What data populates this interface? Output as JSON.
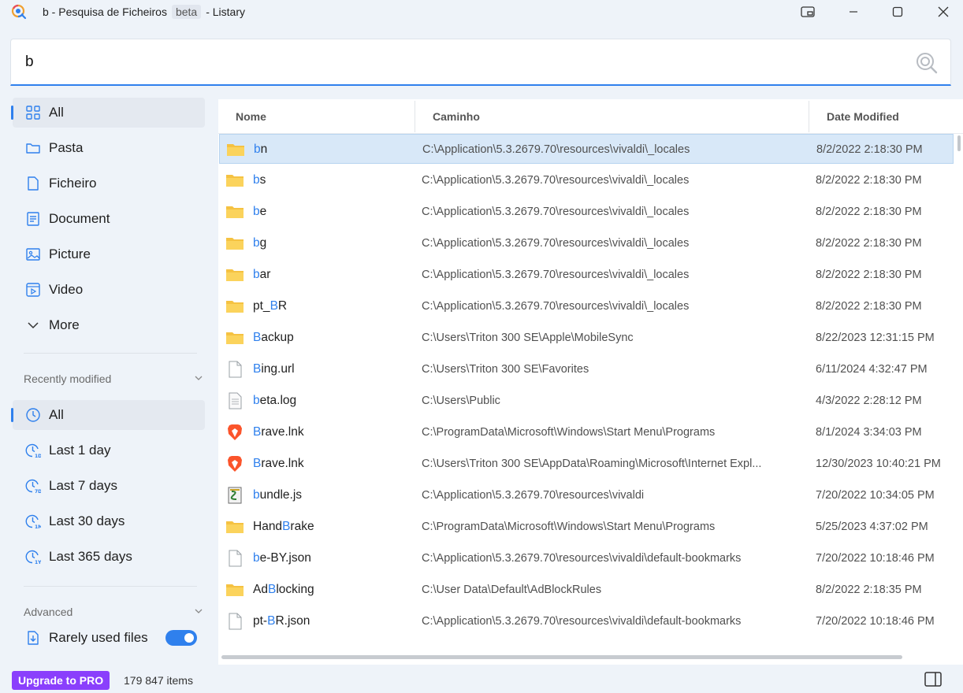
{
  "window": {
    "title": "b - Pesquisa de Ficheiros",
    "badge": "beta",
    "suffix": "- Listary"
  },
  "search": {
    "query": "b"
  },
  "sidebar": {
    "types": [
      {
        "label": "All",
        "icon": "grid-icon",
        "active": true
      },
      {
        "label": "Pasta",
        "icon": "folder-icon"
      },
      {
        "label": "Ficheiro",
        "icon": "file-icon"
      },
      {
        "label": "Document",
        "icon": "document-icon"
      },
      {
        "label": "Picture",
        "icon": "picture-icon"
      },
      {
        "label": "Video",
        "icon": "video-icon"
      },
      {
        "label": "More",
        "icon": "chevron-down-icon"
      }
    ],
    "recent_title": "Recently modified",
    "recent": [
      {
        "label": "All",
        "active": true
      },
      {
        "label": "Last 1 day"
      },
      {
        "label": "Last 7 days"
      },
      {
        "label": "Last 30 days"
      },
      {
        "label": "Last 365 days"
      }
    ],
    "advanced_title": "Advanced",
    "rarely_used": "Rarely used files"
  },
  "table": {
    "headers": {
      "name": "Nome",
      "path": "Caminho",
      "date": "Date Modified"
    },
    "rows": [
      {
        "pre": "",
        "hl": "b",
        "post": "n",
        "type": "folder",
        "path": "C:\\Application\\5.3.2679.70\\resources\\vivaldi\\_locales",
        "date": "8/2/2022 2:18:30 PM",
        "selected": true
      },
      {
        "pre": "",
        "hl": "b",
        "post": "s",
        "type": "folder",
        "path": "C:\\Application\\5.3.2679.70\\resources\\vivaldi\\_locales",
        "date": "8/2/2022 2:18:30 PM"
      },
      {
        "pre": "",
        "hl": "b",
        "post": "e",
        "type": "folder",
        "path": "C:\\Application\\5.3.2679.70\\resources\\vivaldi\\_locales",
        "date": "8/2/2022 2:18:30 PM"
      },
      {
        "pre": "",
        "hl": "b",
        "post": "g",
        "type": "folder",
        "path": "C:\\Application\\5.3.2679.70\\resources\\vivaldi\\_locales",
        "date": "8/2/2022 2:18:30 PM"
      },
      {
        "pre": "",
        "hl": "b",
        "post": "ar",
        "type": "folder",
        "path": "C:\\Application\\5.3.2679.70\\resources\\vivaldi\\_locales",
        "date": "8/2/2022 2:18:30 PM"
      },
      {
        "pre": "pt_",
        "hl": "B",
        "post": "R",
        "type": "folder",
        "path": "C:\\Application\\5.3.2679.70\\resources\\vivaldi\\_locales",
        "date": "8/2/2022 2:18:30 PM"
      },
      {
        "pre": "",
        "hl": "B",
        "post": "ackup",
        "type": "folder",
        "path": "C:\\Users\\Triton 300 SE\\Apple\\MobileSync",
        "date": "8/22/2023 12:31:15 PM"
      },
      {
        "pre": "",
        "hl": "B",
        "post": "ing.url",
        "type": "file",
        "path": "C:\\Users\\Triton 300 SE\\Favorites",
        "date": "6/11/2024 4:32:47 PM"
      },
      {
        "pre": "",
        "hl": "b",
        "post": "eta.log",
        "type": "log",
        "path": "C:\\Users\\Public",
        "date": "4/3/2022 2:28:12 PM"
      },
      {
        "pre": "",
        "hl": "B",
        "post": "rave.lnk",
        "type": "brave",
        "path": "C:\\ProgramData\\Microsoft\\Windows\\Start Menu\\Programs",
        "date": "8/1/2024 3:34:03 PM"
      },
      {
        "pre": "",
        "hl": "B",
        "post": "rave.lnk",
        "type": "brave",
        "path": "C:\\Users\\Triton 300 SE\\AppData\\Roaming\\Microsoft\\Internet Expl...",
        "date": "12/30/2023 10:40:21 PM"
      },
      {
        "pre": "",
        "hl": "b",
        "post": "undle.js",
        "type": "script",
        "path": "C:\\Application\\5.3.2679.70\\resources\\vivaldi",
        "date": "7/20/2022 10:34:05 PM"
      },
      {
        "pre": "Hand",
        "hl": "B",
        "post": "rake",
        "type": "folder",
        "path": "C:\\ProgramData\\Microsoft\\Windows\\Start Menu\\Programs",
        "date": "5/25/2023 4:37:02 PM"
      },
      {
        "pre": "",
        "hl": "b",
        "post": "e-BY.json",
        "type": "file",
        "path": "C:\\Application\\5.3.2679.70\\resources\\vivaldi\\default-bookmarks",
        "date": "7/20/2022 10:18:46 PM"
      },
      {
        "pre": "Ad",
        "hl": "B",
        "post": "locking",
        "type": "folder",
        "path": "C:\\User Data\\Default\\AdBlockRules",
        "date": "8/2/2022 2:18:35 PM"
      },
      {
        "pre": "pt-",
        "hl": "B",
        "post": "R.json",
        "type": "file",
        "path": "C:\\Application\\5.3.2679.70\\resources\\vivaldi\\default-bookmarks",
        "date": "7/20/2022 10:18:46 PM"
      }
    ]
  },
  "status": {
    "upgrade": "Upgrade to PRO",
    "count": "179 847 items"
  },
  "colors": {
    "accent": "#2f80ed",
    "upgrade": "#8a3ffc",
    "folder": "#f5c242"
  }
}
